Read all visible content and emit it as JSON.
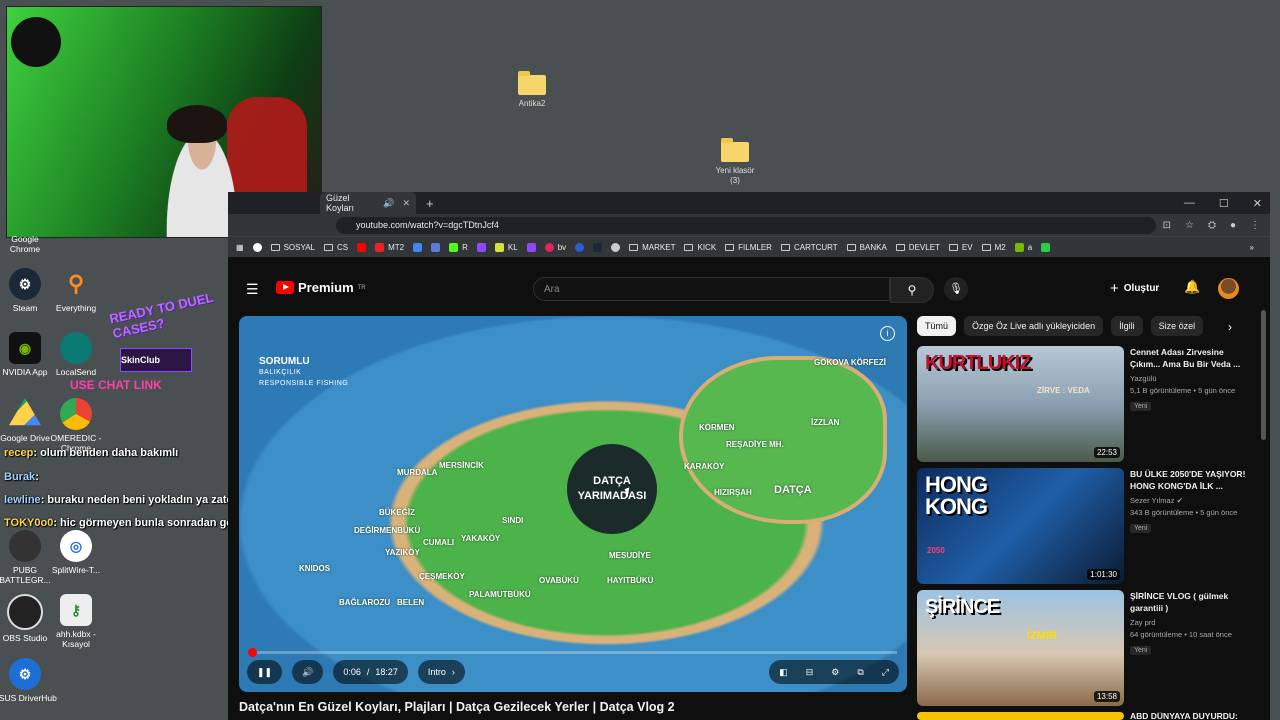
{
  "desktop": {
    "folders": [
      {
        "label": "Antika2"
      },
      {
        "label": "Yeni klasör",
        "sub": "(3)"
      }
    ],
    "icons": [
      {
        "label": "Google Chrome"
      },
      {
        "label": "Steam"
      },
      {
        "label": "Everything"
      },
      {
        "label": "NVIDIA App"
      },
      {
        "label": "LocalSend"
      },
      {
        "label": "Google Drive"
      },
      {
        "label": "OMEREDIC - Chrome"
      },
      {
        "label": "PUBG BATTLEGR..."
      },
      {
        "label": "SplitWire-T..."
      },
      {
        "label": "OBS Studio"
      },
      {
        "label": "ahh.kdbx - Kısayol"
      },
      {
        "label": "ASUS DriverHub"
      }
    ]
  },
  "promo": {
    "headline": "READY TO DUEL CASES?",
    "brand": "SkinClub",
    "cta": "USE CHAT LINK"
  },
  "chat": [
    {
      "user": "recep",
      "text": ": olum benden daha bakımlı"
    },
    {
      "user": "Burak",
      "text": ":"
    },
    {
      "user": "lewline",
      "text": ": buraku neden beni yokladın ya zaten mimliyiz"
    },
    {
      "user": "TOKY0o0",
      "text": ": hic görmeyen bunla sonradan görme deil ya"
    }
  ],
  "browser": {
    "tab_title": "Güzel Koyları",
    "url": "youtube.com/watch?v=dgcTDtnJcf4",
    "bookmarks": [
      "SOSYAL",
      "CS",
      "MT2",
      "R",
      "KL",
      "bv",
      "MARKET",
      "KICK",
      "FILMLER",
      "CARTCURT",
      "BANKA",
      "DEVLET",
      "EV",
      "M2",
      "a"
    ]
  },
  "youtube": {
    "brand": "Premium",
    "region": "TR",
    "search_placeholder": "Ara",
    "create_label": "Oluştur",
    "video": {
      "title": "Datça'nın En Güzel Koyları, Plajları | Datça Gezilecek Yerler | Datça Vlog 2",
      "time_current": "0:06",
      "time_total": "18:27",
      "time_sep": "/",
      "chapter": "Intro",
      "progress": 0.005,
      "center_label": "DATÇA YARIMADASI",
      "sign": "SORUMLU",
      "sign_sub1": "BALIKÇILIK",
      "sign_sub2": "RESPONSIBLE FISHING",
      "places": [
        "GÖKOVA KÖRFEZİ",
        "KÖRMEN",
        "REŞADİYE MH.",
        "İZZLAN",
        "DATÇA",
        "HIZIRŞAH",
        "KARAKÖY",
        "MURDALA",
        "MERSİNCİK",
        "BÜKEĞİZ",
        "DEĞİRMENBÜKÜ",
        "CUMALI",
        "YAKAKÖY",
        "SINDI",
        "MESUDİYE",
        "YAZIKÖY",
        "KNIDOS",
        "ÇEŞMEKÖY",
        "BELEN",
        "PALAMUTBÜKÜ",
        "OVABÜKÜ",
        "HAYITBÜKÜ",
        "BAĞLAROZU"
      ]
    },
    "chips": [
      "Tümü",
      "Özge Öz Live adlı yükleyiciden",
      "İlgili",
      "Size özel"
    ],
    "recommendations": [
      {
        "thumb_text": "KURTLUKIZ",
        "thumb_sub": "ZİRVE : VEDA",
        "duration": "22:53",
        "title": "Cennet Adası Zirvesine Çıkım... Ama Bu Bir Veda ...",
        "channel": "Yazgülü",
        "meta": "5,1 B görüntüleme • 5 gün önce",
        "badge": "Yeni"
      },
      {
        "thumb_text": "HONG KONG",
        "thumb_sub": "2050",
        "duration": "1:01:30",
        "title": "BU ÜLKE 2050'DE YAŞIYOR! HONG KONG'DA İLK ...",
        "channel": "Sezer Yılmaz",
        "meta": "343 B görüntüleme • 5 gün önce",
        "badge": "Yeni"
      },
      {
        "thumb_text": "ŞİRİNCE",
        "thumb_sub": "İZMİR",
        "duration": "13:58",
        "title": "ŞİRİNCE VLOG ( gülmek garantiii )",
        "channel": "Zay prd",
        "meta": "64 görüntüleme • 10 saat önce",
        "badge": "Yeni"
      },
      {
        "title": "ABD DÜNYAYA DUYURDU:"
      }
    ]
  },
  "colors": {
    "desktop_bg": "#4a5052",
    "yt_red": "#ff0000",
    "yt_bg": "#0f0f0f"
  }
}
